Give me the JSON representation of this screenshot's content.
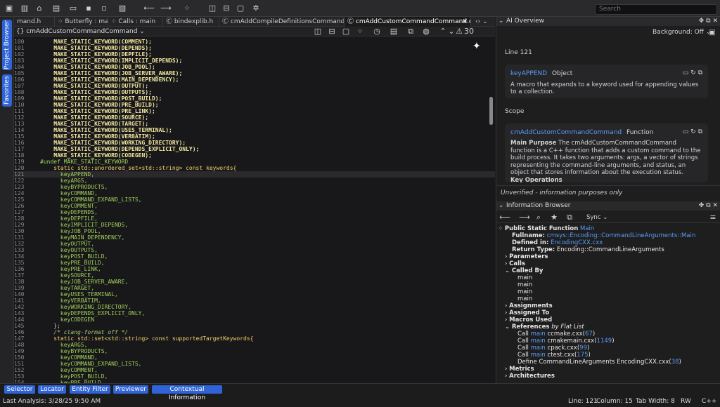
{
  "toolbar": {
    "search_placeholder": "Search"
  },
  "sidebar": {
    "project_browser": "Project Browser",
    "favorites": "Favorites"
  },
  "tabs": [
    {
      "label": "mand.h"
    },
    {
      "label": "Butterfly : main"
    },
    {
      "label": "Calls : main"
    },
    {
      "label": "bindexplib.h"
    },
    {
      "label": "cmAddCompileDefinitionsCommand.h"
    },
    {
      "label": "cmAddCustomCommandCommand.cxx"
    }
  ],
  "breadcrumb": {
    "label": "{} cmAddCustomCommandCommand ⌄"
  },
  "editor": {
    "warning_count": "30",
    "lines": [
      {
        "n": "100",
        "t": "    MAKE_STATIC_KEYWORD(COMMENT);"
      },
      {
        "n": "101",
        "t": "    MAKE_STATIC_KEYWORD(DEPENDS);"
      },
      {
        "n": "102",
        "t": "    MAKE_STATIC_KEYWORD(DEPFILE);"
      },
      {
        "n": "103",
        "t": "    MAKE_STATIC_KEYWORD(IMPLICIT_DEPENDS);"
      },
      {
        "n": "104",
        "t": "    MAKE_STATIC_KEYWORD(JOB_POOL);"
      },
      {
        "n": "105",
        "t": "    MAKE_STATIC_KEYWORD(JOB_SERVER_AWARE);"
      },
      {
        "n": "106",
        "t": "    MAKE_STATIC_KEYWORD(MAIN_DEPENDENCY);"
      },
      {
        "n": "107",
        "t": "    MAKE_STATIC_KEYWORD(OUTPUT);"
      },
      {
        "n": "108",
        "t": "    MAKE_STATIC_KEYWORD(OUTPUTS);"
      },
      {
        "n": "109",
        "t": "    MAKE_STATIC_KEYWORD(POST_BUILD);"
      },
      {
        "n": "110",
        "t": "    MAKE_STATIC_KEYWORD(PRE_BUILD);"
      },
      {
        "n": "111",
        "t": "    MAKE_STATIC_KEYWORD(PRE_LINK);"
      },
      {
        "n": "112",
        "t": "    MAKE_STATIC_KEYWORD(SOURCE);"
      },
      {
        "n": "113",
        "t": "    MAKE_STATIC_KEYWORD(TARGET);"
      },
      {
        "n": "114",
        "t": "    MAKE_STATIC_KEYWORD(USES_TERMINAL);"
      },
      {
        "n": "115",
        "t": "    MAKE_STATIC_KEYWORD(VERBATIM);"
      },
      {
        "n": "116",
        "t": "    MAKE_STATIC_KEYWORD(WORKING_DIRECTORY);"
      },
      {
        "n": "117",
        "t": "    MAKE_STATIC_KEYWORD(DEPENDS_EXPLICIT_ONLY);"
      },
      {
        "n": "118",
        "t": "    MAKE_STATIC_KEYWORD(CODEGEN);"
      },
      {
        "n": "119",
        "t": "#undef MAKE_STATIC_KEYWORD"
      },
      {
        "n": "120",
        "t": "    static std::unordered_set<std::string> const keywords{"
      },
      {
        "n": "121",
        "t": "      keyAPPEND,"
      },
      {
        "n": "122",
        "t": "      keyARGS,"
      },
      {
        "n": "123",
        "t": "      keyBYPRODUCTS,"
      },
      {
        "n": "124",
        "t": "      keyCOMMAND,"
      },
      {
        "n": "125",
        "t": "      keyCOMMAND_EXPAND_LISTS,"
      },
      {
        "n": "126",
        "t": "      keyCOMMENT,"
      },
      {
        "n": "127",
        "t": "      keyDEPENDS,"
      },
      {
        "n": "128",
        "t": "      keyDEPFILE,"
      },
      {
        "n": "129",
        "t": "      keyIMPLICIT_DEPENDS,"
      },
      {
        "n": "130",
        "t": "      keyJOB_POOL,"
      },
      {
        "n": "131",
        "t": "      keyMAIN_DEPENDENCY,"
      },
      {
        "n": "132",
        "t": "      keyOUTPUT,"
      },
      {
        "n": "133",
        "t": "      keyOUTPUTS,"
      },
      {
        "n": "134",
        "t": "      keyPOST_BUILD,"
      },
      {
        "n": "135",
        "t": "      keyPRE_BUILD,"
      },
      {
        "n": "136",
        "t": "      keyPRE_LINK,"
      },
      {
        "n": "137",
        "t": "      keySOURCE,"
      },
      {
        "n": "138",
        "t": "      keyJOB_SERVER_AWARE,"
      },
      {
        "n": "139",
        "t": "      keyTARGET,"
      },
      {
        "n": "140",
        "t": "      keyUSES_TERMINAL,"
      },
      {
        "n": "141",
        "t": "      keyVERBATIM,"
      },
      {
        "n": "142",
        "t": "      keyWORKING_DIRECTORY,"
      },
      {
        "n": "143",
        "t": "      keyDEPENDS_EXPLICIT_ONLY,"
      },
      {
        "n": "144",
        "t": "      keyCODEGEN"
      },
      {
        "n": "145",
        "t": "    };"
      },
      {
        "n": "146",
        "t": "    /* clang-format off */"
      },
      {
        "n": "147",
        "t": "    static std::set<std::string> const supportedTargetKeywords{"
      },
      {
        "n": "148",
        "t": "      keyARGS,"
      },
      {
        "n": "149",
        "t": "      keyBYPRODUCTS,"
      },
      {
        "n": "150",
        "t": "      keyCOMMAND,"
      },
      {
        "n": "151",
        "t": "      keyCOMMAND_EXPAND_LISTS,"
      },
      {
        "n": "152",
        "t": "      keyCOMMENT,"
      },
      {
        "n": "153",
        "t": "      keyPOST_BUILD,"
      },
      {
        "n": "154",
        "t": "      keyPRE_BUILD,"
      }
    ]
  },
  "ai": {
    "title": "AI Overview",
    "background": "Background: Off ⌄",
    "line_label": "Line 121",
    "card1": {
      "name": "keyAPPEND",
      "kind": "Object",
      "desc": "A macro that expands to a keyword used for appending values to a collection."
    },
    "scope": "Scope",
    "card2": {
      "name": "cmAddCustomCommandCommand",
      "kind": "Function",
      "heading": "Main Purpose",
      "body": "The cmAddCustomCommandCommand function is a C++ function that adds a custom command to the build process. It takes two arguments: args, a vector of strings representing the command-line arguments, and status, an object that stores information about the execution status.",
      "more": "Key Operations"
    },
    "footer": "Unverified - information purposes only"
  },
  "info": {
    "title": "Information Browser",
    "sync": "Sync ⌄",
    "header": "Public Static Function",
    "header_name": "Main",
    "fullname_label": "Fullname:",
    "fullname": "cmsys::Encoding::CommandLineArguments::Main",
    "defined_label": "Defined in:",
    "defined": "EncodingCXX.cxx",
    "return_label": "Return Type:",
    "return": "Encoding::CommandLineArguments",
    "parameters": "Parameters",
    "calls": "Calls",
    "called_by": "Called By",
    "called_by_items": [
      "main",
      "main",
      "main",
      "main"
    ],
    "assignments": "Assignments",
    "assigned_to": "Assigned To",
    "macros_used": "Macros Used",
    "references": "References",
    "references_suffix": "by Flat List",
    "refs": [
      {
        "kind": "Call",
        "fn": "main",
        "file": "ccmake.cxx",
        "line": "67"
      },
      {
        "kind": "Call",
        "fn": "main",
        "file": "cmakemain.cxx",
        "line": "1149"
      },
      {
        "kind": "Call",
        "fn": "main",
        "file": "cpack.cxx",
        "line": "99"
      },
      {
        "kind": "Call",
        "fn": "main",
        "file": "ctest.cxx",
        "line": "175"
      }
    ],
    "define": {
      "kind": "Define",
      "name": "CommandLineArguments",
      "file": "EncodingCXX.cxx",
      "line": "38"
    },
    "metrics": "Metrics",
    "architectures": "Architectures"
  },
  "status": {
    "buttons": [
      "Selector",
      "Locator",
      "Entity Filter",
      "Previewer",
      "Contextual Information"
    ],
    "last_analysis": "Last Analysis: 3/28/25 9:50 AM",
    "line": "Line: 121",
    "column": "Column: 15",
    "tab_width": "Tab Width: 8",
    "mode": "RW",
    "language": "C++"
  }
}
